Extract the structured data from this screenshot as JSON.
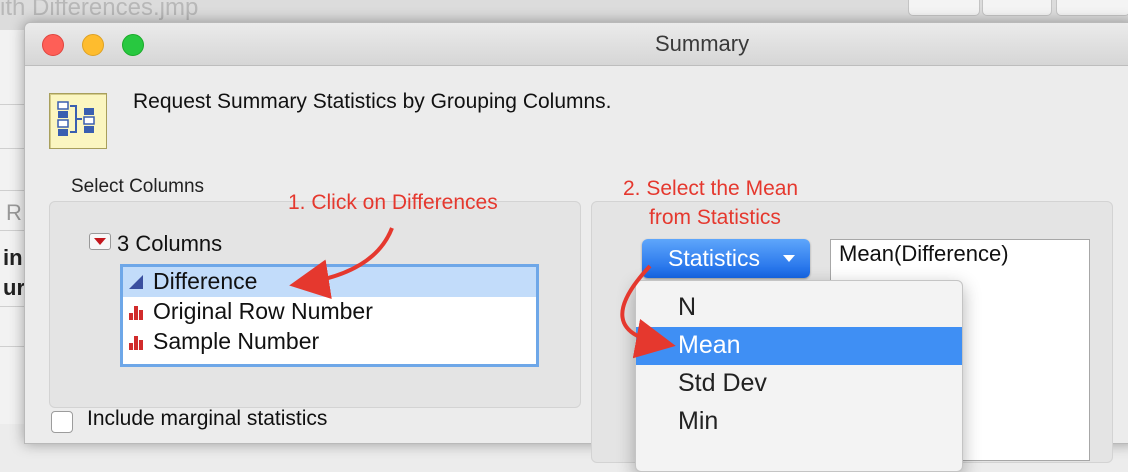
{
  "background_window": {
    "title": "ith Differences.jmp",
    "side_letters": [
      "R",
      "in",
      "ur"
    ]
  },
  "dialog": {
    "title": "Summary",
    "header_text": "Request Summary Statistics by Grouping Columns."
  },
  "select_columns": {
    "label": "Select Columns",
    "count_label": "3 Columns",
    "columns": [
      {
        "name": "Difference",
        "icon": "continuous-triangle-icon",
        "selected": true
      },
      {
        "name": "Original Row Number",
        "icon": "bar-chart-icon",
        "selected": false
      },
      {
        "name": "Sample Number",
        "icon": "bar-chart-icon",
        "selected": false
      }
    ]
  },
  "include_marginal": {
    "label": "Include marginal statistics",
    "checked": false
  },
  "statistics": {
    "button_label": "Statistics",
    "selected_list": [
      "Mean(Difference)"
    ],
    "menu_items": [
      {
        "label": "N",
        "highlighted": false
      },
      {
        "label": "Mean",
        "highlighted": true
      },
      {
        "label": "Std Dev",
        "highlighted": false
      },
      {
        "label": "Min",
        "highlighted": false
      }
    ]
  },
  "annotations": {
    "step1": "1. Click on Differences",
    "step2_line1": "2. Select the Mean",
    "step2_line2": "from Statistics"
  },
  "colors": {
    "accent": "#3f8ff4",
    "annotation": "#e5382e",
    "selection": "#c2dcfa"
  }
}
